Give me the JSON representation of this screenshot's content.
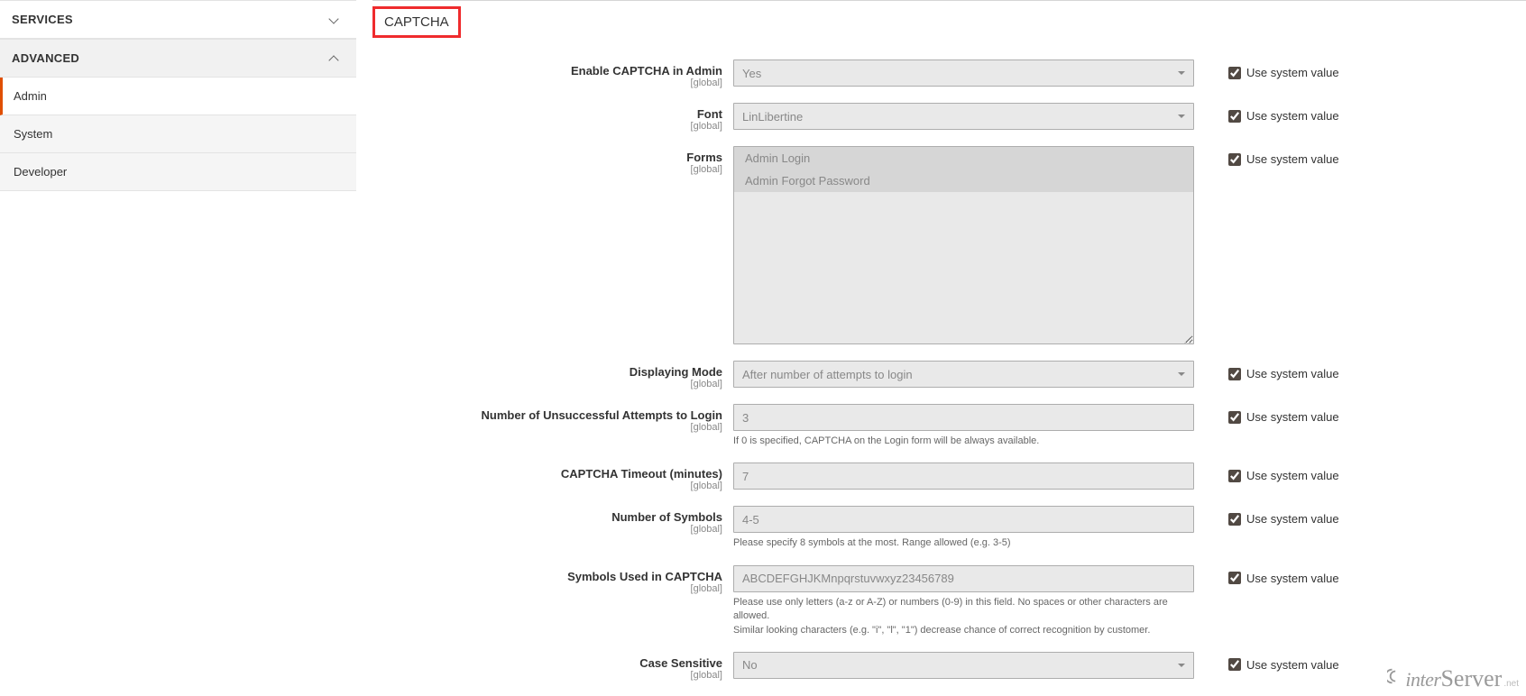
{
  "sidebar": {
    "services_label": "SERVICES",
    "advanced_label": "ADVANCED",
    "items": [
      {
        "label": "Admin"
      },
      {
        "label": "System"
      },
      {
        "label": "Developer"
      }
    ]
  },
  "section_title": "CAPTCHA",
  "sysval_label": "Use system value",
  "scope_global": "[global]",
  "fields": {
    "enable": {
      "label": "Enable CAPTCHA in Admin",
      "value": "Yes",
      "sysval": true
    },
    "font": {
      "label": "Font",
      "value": "LinLibertine",
      "sysval": true
    },
    "forms": {
      "label": "Forms",
      "opts": [
        "Admin Login",
        "Admin Forgot Password"
      ],
      "sysval": true
    },
    "mode": {
      "label": "Displaying Mode",
      "value": "After number of attempts to login",
      "sysval": true
    },
    "attempts": {
      "label": "Number of Unsuccessful Attempts to Login",
      "value": "3",
      "note": "If 0 is specified, CAPTCHA on the Login form will be always available.",
      "sysval": true
    },
    "timeout": {
      "label": "CAPTCHA Timeout (minutes)",
      "value": "7",
      "sysval": true
    },
    "symcount": {
      "label": "Number of Symbols",
      "value": "4-5",
      "note": "Please specify 8 symbols at the most. Range allowed (e.g. 3-5)",
      "sysval": true
    },
    "symbols": {
      "label": "Symbols Used in CAPTCHA",
      "value": "ABCDEFGHJKMnpqrstuvwxyz23456789",
      "note": "Please use only letters (a-z or A-Z) or numbers (0-9) in this field. No spaces or other characters are allowed.\nSimilar looking characters (e.g. \"i\", \"l\", \"1\") decrease chance of correct recognition by customer.",
      "sysval": true
    },
    "case": {
      "label": "Case Sensitive",
      "value": "No",
      "sysval": true
    }
  },
  "watermark": {
    "brand_prefix": "inter",
    "brand_suffix": "Server",
    "tld": ".net"
  }
}
